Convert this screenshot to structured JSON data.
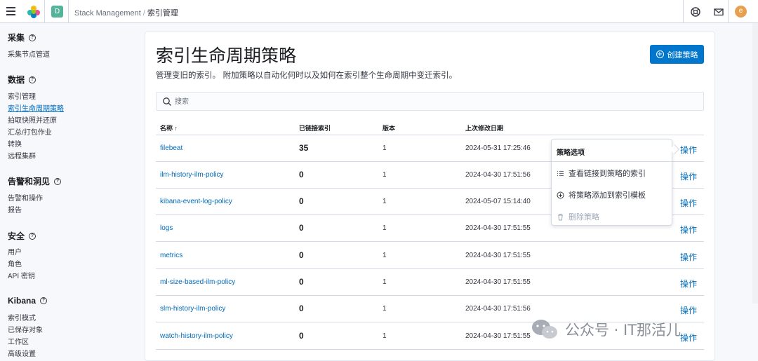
{
  "header": {
    "space_initial": "D",
    "breadcrumbs": [
      "Stack Management",
      "索引管理"
    ],
    "avatar_initial": "e"
  },
  "sidebar": {
    "sections": [
      {
        "title": "采集",
        "items": [
          "采集节点管道"
        ]
      },
      {
        "title": "数据",
        "items": [
          "索引管理",
          "索引生命周期策略",
          "拍取快照并还原",
          "汇总/打包作业",
          "转换",
          "远程集群"
        ]
      },
      {
        "title": "告警和洞见",
        "items": [
          "告警和操作",
          "报告"
        ]
      },
      {
        "title": "安全",
        "items": [
          "用户",
          "角色",
          "API 密钥"
        ]
      },
      {
        "title": "Kibana",
        "items": [
          "索引模式",
          "已保存对象",
          "工作区",
          "高级设置"
        ]
      }
    ],
    "active_item": "索引生命周期策略"
  },
  "main": {
    "title": "索引生命周期策略",
    "description": "管理变旧的索引。 附加策略以自动化何时以及如何在索引整个生命周期中变迁索引。",
    "create_button": "创建策略",
    "search_placeholder": "搜索",
    "columns": {
      "name": "名称",
      "linked": "已链接索引",
      "version": "版本",
      "modified": "上次修改日期"
    },
    "sort_indicator": "↑",
    "rows": [
      {
        "name": "filebeat",
        "linked": "35",
        "version": "1",
        "modified": "2024-05-31 17:25:46",
        "action": "操作"
      },
      {
        "name": "ilm-history-ilm-policy",
        "linked": "0",
        "version": "1",
        "modified": "2024-04-30 17:51:56",
        "action": "操作"
      },
      {
        "name": "kibana-event-log-policy",
        "linked": "0",
        "version": "1",
        "modified": "2024-05-07 15:14:40",
        "action": "操作"
      },
      {
        "name": "logs",
        "linked": "0",
        "version": "1",
        "modified": "2024-04-30 17:51:55",
        "action": "操作"
      },
      {
        "name": "metrics",
        "linked": "0",
        "version": "1",
        "modified": "2024-04-30 17:51:55",
        "action": "操作"
      },
      {
        "name": "ml-size-based-ilm-policy",
        "linked": "0",
        "version": "1",
        "modified": "2024-04-30 17:51:55",
        "action": "操作"
      },
      {
        "name": "slm-history-ilm-policy",
        "linked": "0",
        "version": "1",
        "modified": "2024-04-30 17:51:56",
        "action": "操作"
      },
      {
        "name": "watch-history-ilm-policy",
        "linked": "0",
        "version": "1",
        "modified": "2024-04-30 17:51:55",
        "action": "操作"
      }
    ]
  },
  "popover": {
    "title": "策略选项",
    "items": [
      {
        "label": "查看链接到策略的索引",
        "icon": "list-icon",
        "disabled": false
      },
      {
        "label": "将策略添加到索引模板",
        "icon": "plus-circle-icon",
        "disabled": false
      },
      {
        "label": "删除策略",
        "icon": "trash-icon",
        "disabled": true
      }
    ]
  },
  "watermark": "公众号 · IT那活儿",
  "colors": {
    "accent": "#0077cc",
    "link": "#006bb8",
    "space_badge": "#54b399",
    "avatar": "#e7a04e"
  }
}
